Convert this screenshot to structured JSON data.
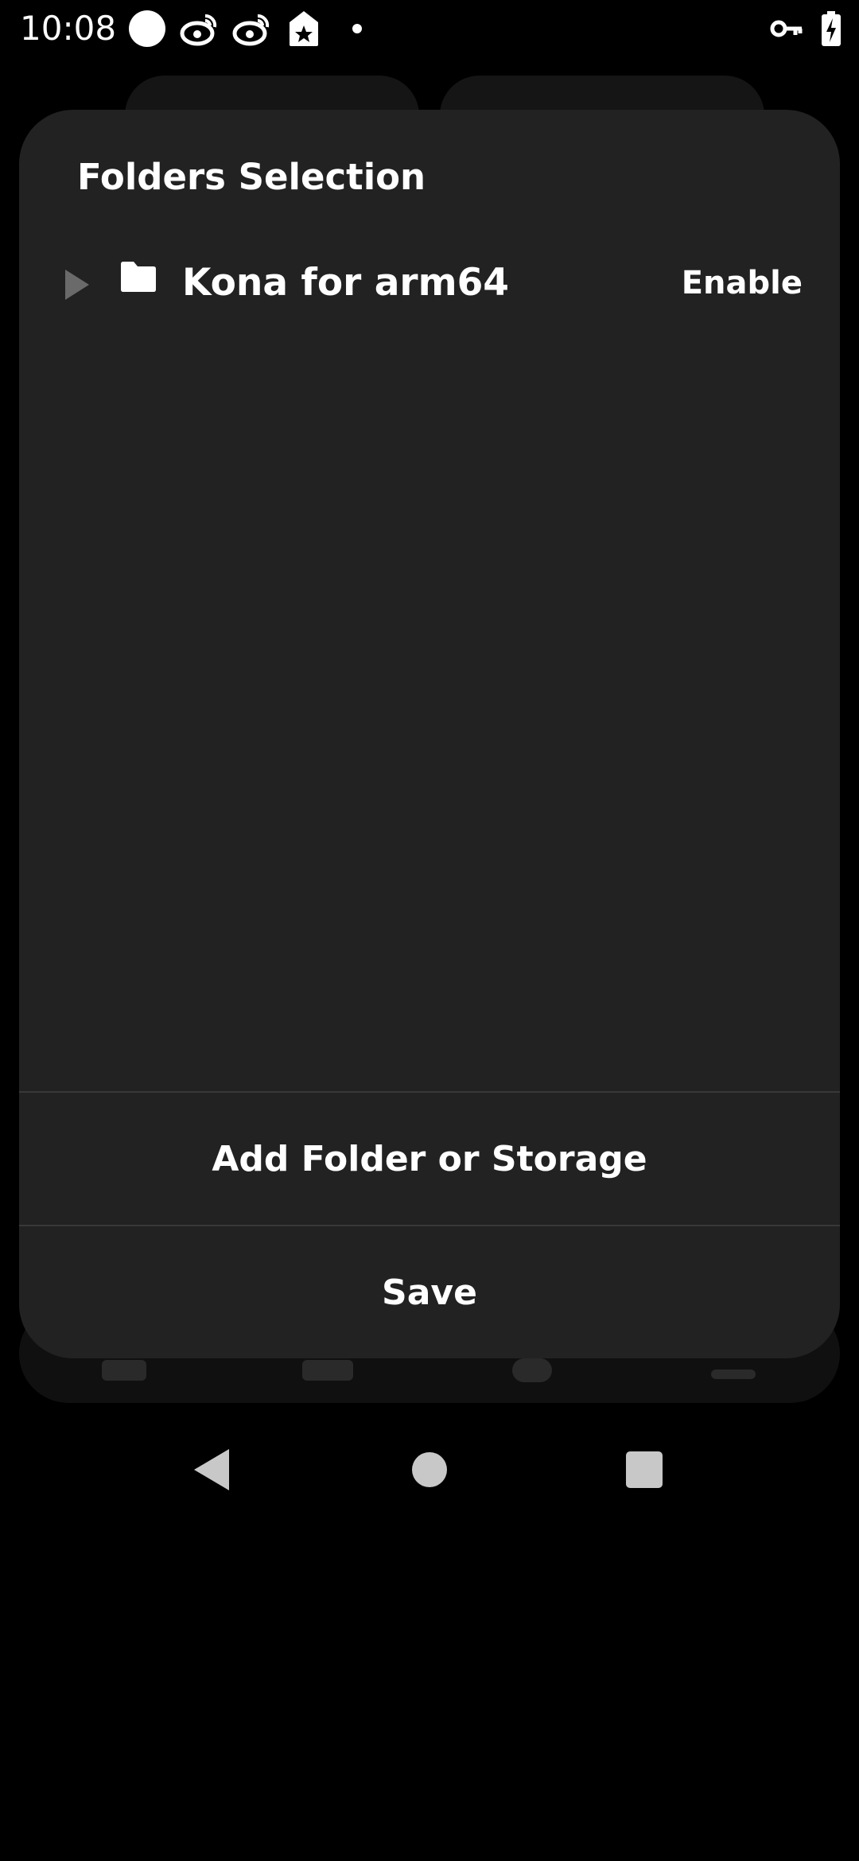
{
  "status_bar": {
    "time": "10:08",
    "left_icons": [
      "circle-notification-icon",
      "weibo-icon",
      "weibo-icon",
      "store-tag-icon",
      "dot-icon"
    ],
    "right_icons": [
      "vpn-key-icon",
      "battery-charging-icon"
    ]
  },
  "dialog": {
    "title": "Folders Selection",
    "folders": [
      {
        "name": "Kona for arm64",
        "action_label": "Enable",
        "expand_icon": "triangle-right-icon",
        "icon": "folder-icon"
      }
    ],
    "add_button_label": "Add Folder or Storage",
    "save_button_label": "Save"
  },
  "system_nav": {
    "icons": [
      "back-icon",
      "home-icon",
      "recents-icon"
    ]
  },
  "colors": {
    "background": "#000000",
    "dialog": "#222222",
    "divider": "#383838",
    "text": "#ffffff",
    "muted_icon": "#6a6a6a"
  }
}
